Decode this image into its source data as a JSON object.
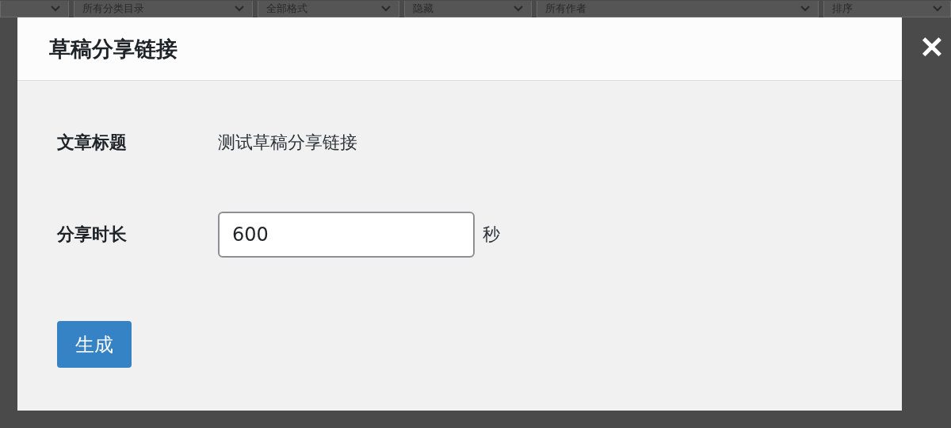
{
  "background_filters": [
    {
      "kind": "unlabeled"
    },
    {
      "kind": "labeled",
      "label": "所有分类目录"
    },
    {
      "kind": "labeled",
      "label": "全部格式"
    },
    {
      "kind": "labeled",
      "label": "隐藏"
    },
    {
      "kind": "labeled",
      "label": "所有作者"
    },
    {
      "kind": "labeled",
      "label": "排序"
    }
  ],
  "dialog": {
    "title": "草稿分享链接",
    "close": "✕",
    "fields": [
      {
        "kind": "text",
        "label": "文章标题",
        "value": "测试草稿分享链接"
      },
      {
        "kind": "input",
        "label": "分享时长",
        "value": "600",
        "unit": "秒"
      }
    ],
    "button": "生成"
  }
}
